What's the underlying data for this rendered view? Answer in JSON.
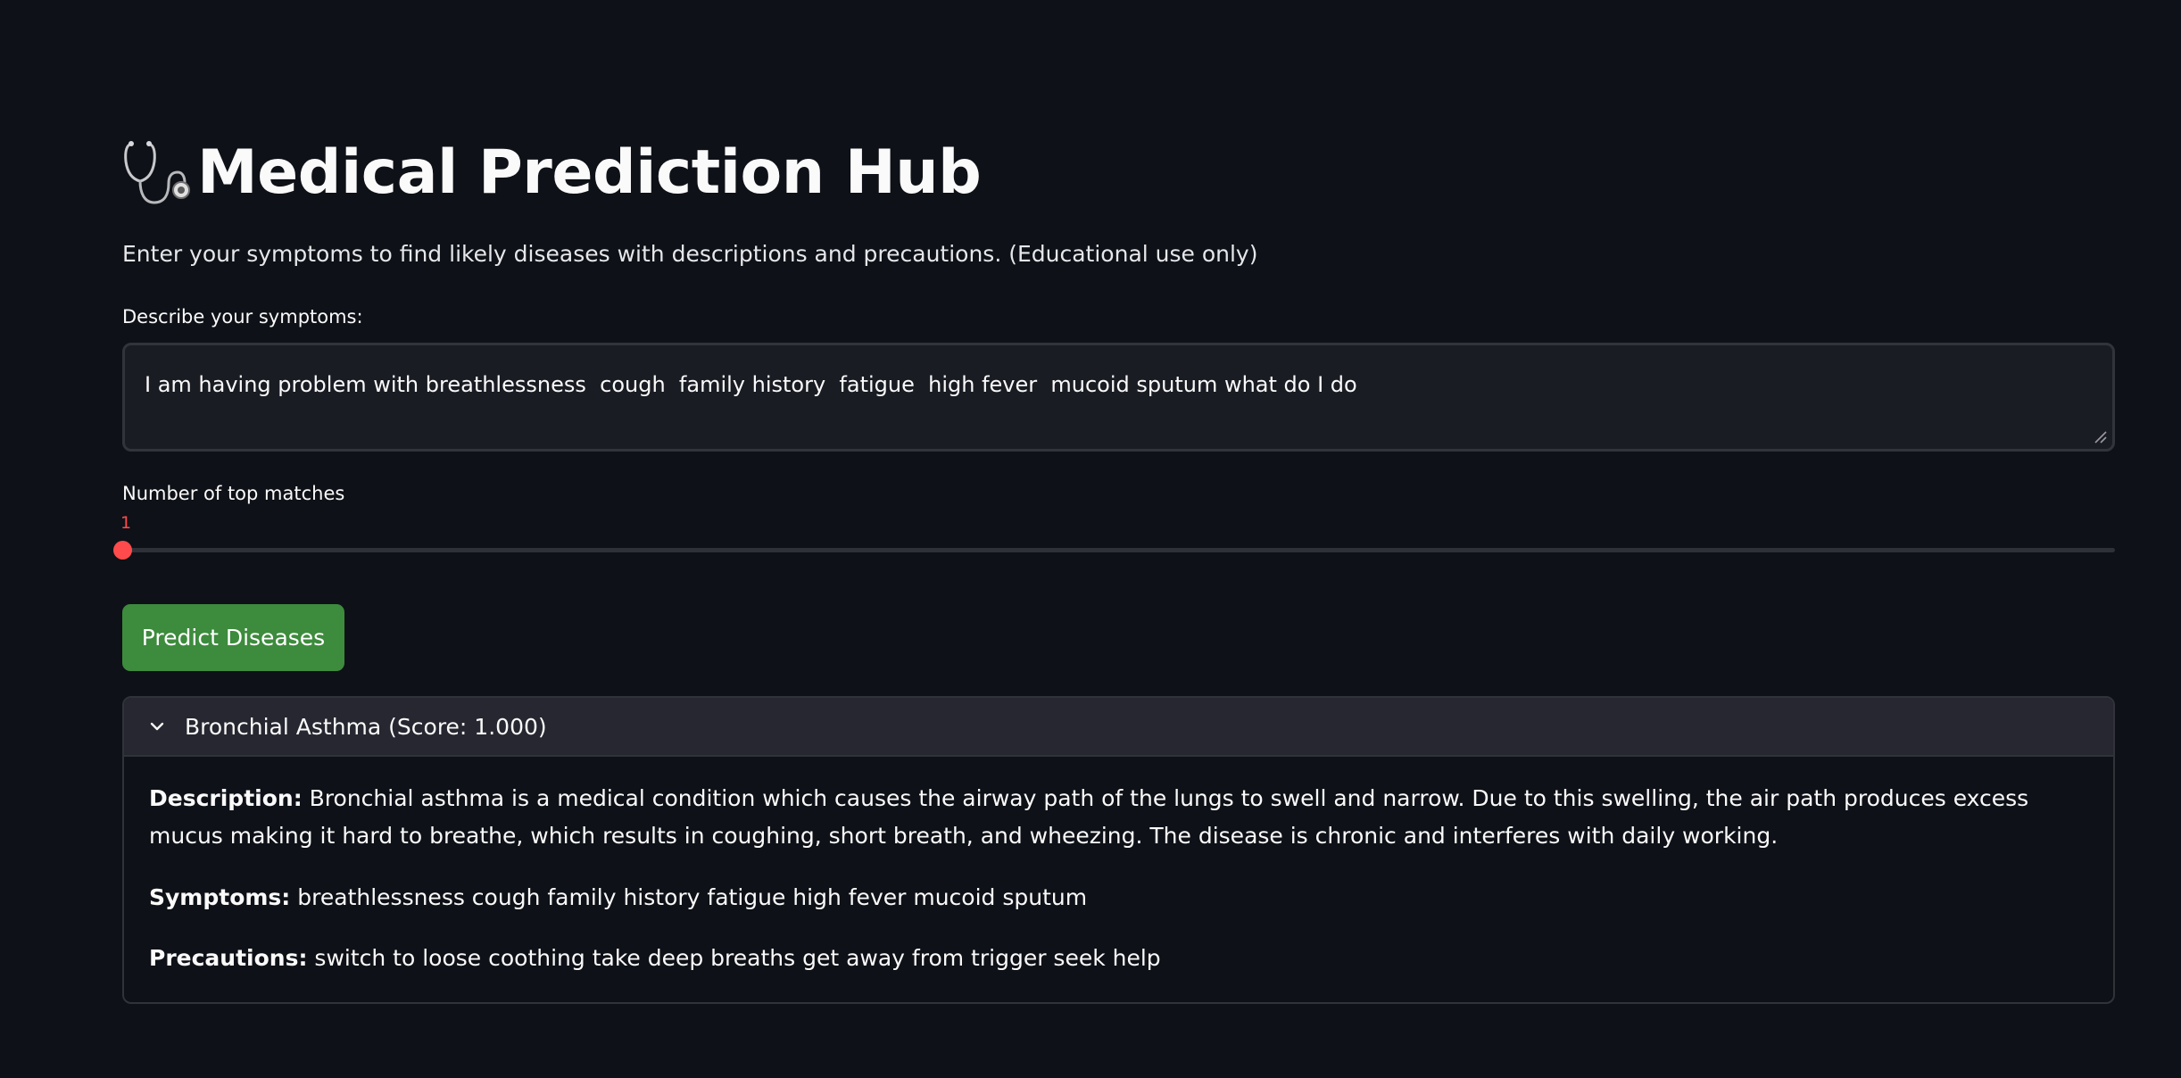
{
  "app": {
    "title": "Medical Prediction Hub",
    "subtitle": "Enter your symptoms to find likely diseases with descriptions and precautions. (Educational use only)",
    "title_icon": "stethoscope-icon"
  },
  "symptoms_input": {
    "label": "Describe your symptoms:",
    "value": "I am having problem with breathlessness  cough  family history  fatigue  high fever  mucoid sputum what do I do"
  },
  "top_matches_slider": {
    "label": "Number of top matches",
    "value": "1",
    "accent_color": "#ff4b4b"
  },
  "predict_button": {
    "label": "Predict Diseases",
    "color": "#3d8b3d"
  },
  "results": [
    {
      "header": "Bronchial Asthma (Score: 1.000)",
      "expanded": true,
      "description_label": "Description:",
      "description": "Bronchial asthma is a medical condition which causes the airway path of the lungs to swell and narrow. Due to this swelling, the air path produces excess mucus making it hard to breathe, which results in coughing, short breath, and wheezing. The disease is chronic and interferes with daily working.",
      "symptoms_label": "Symptoms:",
      "symptoms": "breathlessness cough family history fatigue high fever mucoid sputum",
      "precautions_label": "Precautions:",
      "precautions": "switch to loose coothing take deep breaths get away from trigger seek help"
    }
  ]
}
